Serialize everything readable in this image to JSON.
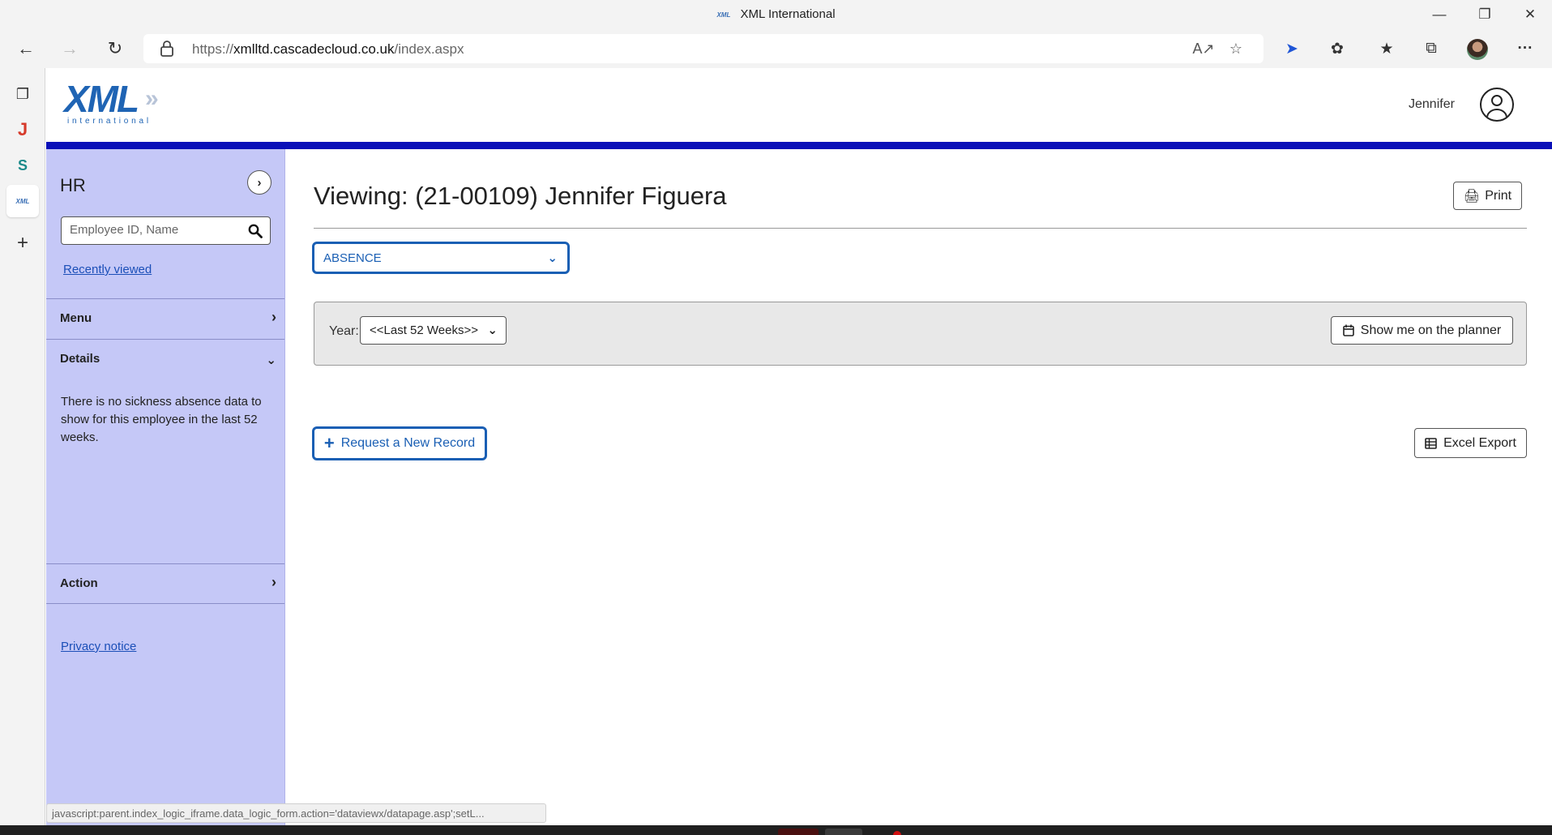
{
  "browser": {
    "window_title": "XML International",
    "tab_favicon": "XML",
    "url_prefix": "https://",
    "url_host": "xmlltd.cascadecloud.co.uk",
    "url_path": "/index.aspx",
    "status_url": "javascript:parent.index_logic_iframe.data_logic_form.action='dataviewx/datapage.asp';setL..."
  },
  "header": {
    "logo_text": "XML",
    "logo_subtext": "international",
    "user_name": "Jennifer",
    "brand_color": "#0a10b8"
  },
  "sidebar": {
    "title": "HR",
    "search_placeholder": "Employee ID, Name",
    "recently_viewed": "Recently viewed",
    "sections": {
      "menu": "Menu",
      "details": "Details",
      "action": "Action"
    },
    "details_text": "There is no sickness absence data to show for this employee in the last 52 weeks.",
    "privacy": "Privacy notice",
    "bg_color": "#c5c8f7"
  },
  "main": {
    "title": "Viewing:  (21-00109) Jennifer Figuera",
    "print_label": "Print",
    "module_value": "ABSENCE",
    "year_label": "Year:",
    "year_value": "<<Last 52 Weeks>>",
    "planner_label": "Show me on the planner",
    "request_label": "Request a New Record",
    "excel_label": "Excel Export",
    "accent_color": "#1a5fb4"
  },
  "icons": [
    "back-icon",
    "forward-icon",
    "refresh-icon",
    "lock-icon",
    "read-aloud-icon",
    "add-favorite-icon",
    "copilot-icon",
    "extensions-icon",
    "favorites-icon",
    "collections-icon",
    "more-icon",
    "user-icon",
    "search-icon",
    "printer-icon",
    "calendar-icon",
    "plus-icon",
    "table-icon"
  ]
}
